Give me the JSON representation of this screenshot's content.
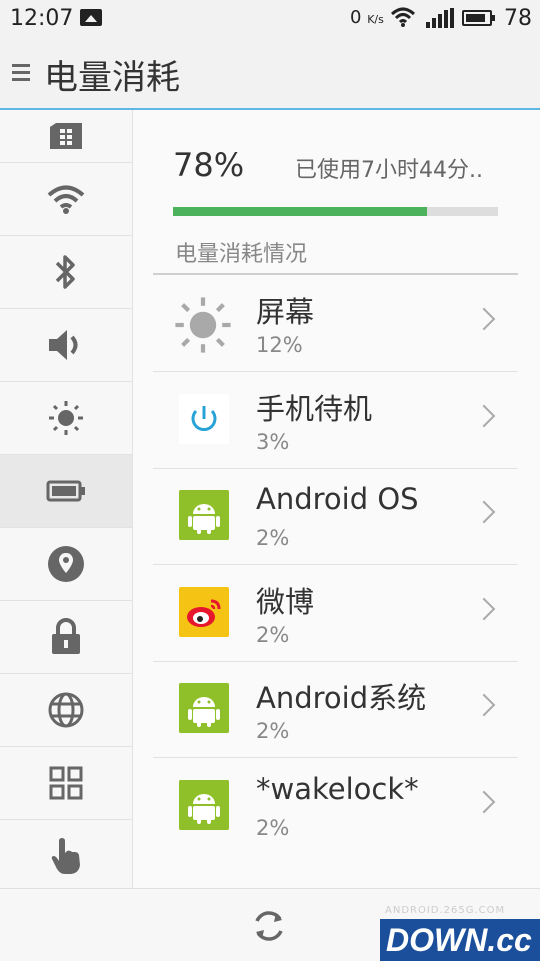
{
  "status_bar": {
    "time": "12:07",
    "net_speed": "0",
    "net_unit": "K/s",
    "battery_level": "78",
    "icons": [
      "gallery-icon",
      "wifi-icon",
      "signal-icon",
      "battery-icon"
    ]
  },
  "header": {
    "title": "电量消耗",
    "menu_icon": "menu-icon"
  },
  "sidebar": {
    "items": [
      {
        "name": "sim-icon",
        "active": false
      },
      {
        "name": "wifi-icon",
        "active": false
      },
      {
        "name": "bluetooth-icon",
        "active": false
      },
      {
        "name": "volume-icon",
        "active": false
      },
      {
        "name": "brightness-icon",
        "active": false
      },
      {
        "name": "battery-icon",
        "active": true
      },
      {
        "name": "location-icon",
        "active": false
      },
      {
        "name": "lock-icon",
        "active": false
      },
      {
        "name": "globe-icon",
        "active": false
      },
      {
        "name": "apps-grid-icon",
        "active": false
      },
      {
        "name": "hand-icon",
        "active": false
      }
    ]
  },
  "battery": {
    "percent_text": "78%",
    "level": 0.78,
    "used_text": "已使用7小时44分..",
    "bar_color": "#4cb35c"
  },
  "consumption": {
    "section_title": "电量消耗情况",
    "items": [
      {
        "name": "屏幕",
        "percent": "12%",
        "icon": "sun-icon"
      },
      {
        "name": "手机待机",
        "percent": "3%",
        "icon": "power-icon"
      },
      {
        "name": "Android OS",
        "percent": "2%",
        "icon": "android-icon"
      },
      {
        "name": "微博",
        "percent": "2%",
        "icon": "weibo-icon"
      },
      {
        "name": "Android系统",
        "percent": "2%",
        "icon": "android-icon"
      },
      {
        "name": "*wakelock*",
        "percent": "2%",
        "icon": "android-icon"
      }
    ]
  },
  "bottom_bar": {
    "refresh_icon": "refresh-icon",
    "watermark_small": "ANDROID.265G.COM",
    "watermark_main": "DOWN.cc"
  }
}
